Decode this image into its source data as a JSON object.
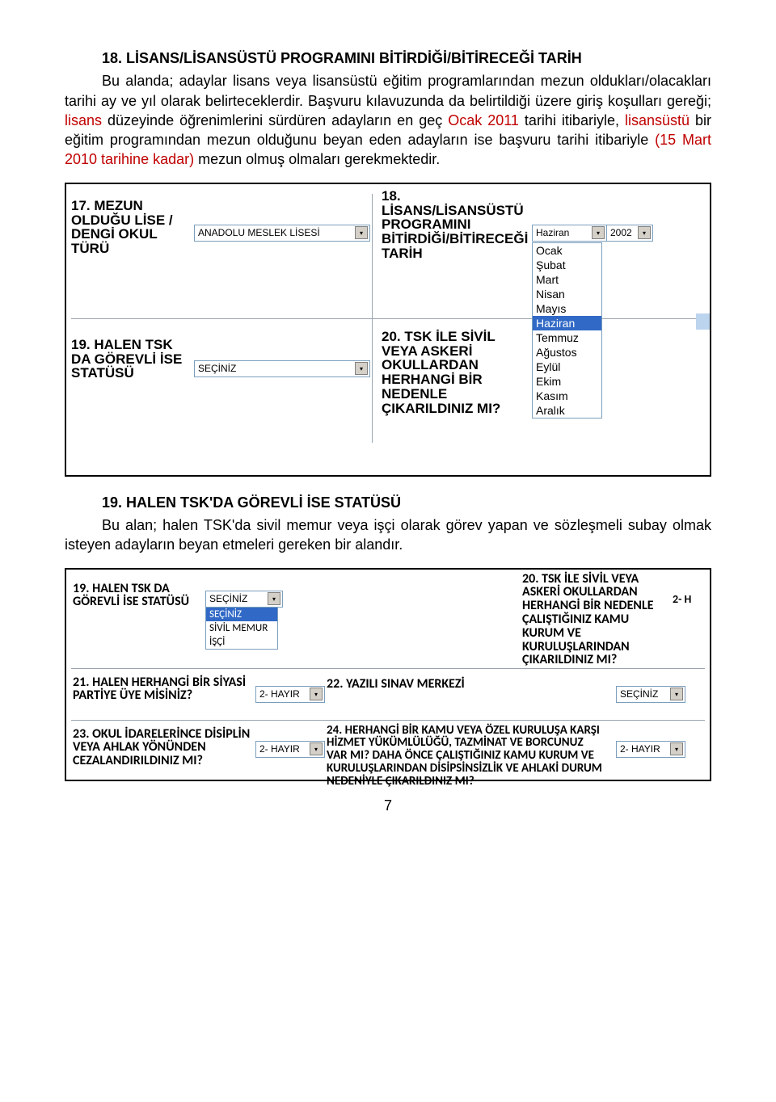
{
  "section18": {
    "title": "18.  LİSANS/LİSANSÜSTÜ PROGRAMINI BİTİRDİĞİ/BİTİRECEĞİ TARİH",
    "body_a": "Bu alanda; adaylar lisans veya lisansüstü eğitim programlarından mezun oldukları/olacakları tarihi ay ve yıl olarak belirteceklerdir. Başvuru kılavuzunda da belirtildiği üzere giriş koşulları gereği; ",
    "body_red1": "lisans",
    "body_b": " düzeyinde öğrenimlerini sürdüren adayların en geç ",
    "body_red2": "Ocak 2011",
    "body_c": " tarihi itibariyle, ",
    "body_red3": "lisansüstü",
    "body_d": " bir eğitim programından mezun olduğunu beyan eden adayların ise başvuru tarihi itibariyle  ",
    "body_red4": "(15 Mart 2010 tarihine kadar) ",
    "body_e": "mezun olmuş olmaları gerekmektedir."
  },
  "shot1": {
    "q17": "17. MEZUN OLDUĞU LİSE / DENGİ OKUL TÜRÜ",
    "q17_val": "ANADOLU MESLEK LİSESİ",
    "q18": "18. LİSANS/LİSANSÜSTÜ PROGRAMINI BİTİRDİĞİ/BİTİRECEĞİ TARİH",
    "q18_month": "Haziran",
    "q18_year": "2002",
    "months": [
      "Ocak",
      "Şubat",
      "Mart",
      "Nisan",
      "Mayıs",
      "Haziran",
      "Temmuz",
      "Ağustos",
      "Eylül",
      "Ekim",
      "Kasım",
      "Aralık"
    ],
    "q19": "19. HALEN TSK DA GÖREVLİ İSE STATÜSÜ",
    "q19_val": "SEÇİNİZ",
    "q20": "20. TSK İLE SİVİL VEYA ASKERİ OKULLARDAN HERHANGİ BİR NEDENLE ÇIKARILDINIZ MI?"
  },
  "section19": {
    "title": "19.  HALEN TSK'DA GÖREVLİ İSE STATÜSÜ",
    "body": "Bu alan; halen TSK'da sivil memur veya işçi olarak görev yapan ve sözleşmeli subay olmak isteyen adayların beyan etmeleri gereken bir alandır."
  },
  "shot2": {
    "q19": "19. HALEN TSK DA GÖREVLİ İSE STATÜSÜ",
    "sel19": "SEÇİNİZ",
    "opts19": [
      "SEÇİNİZ",
      "SİVİL MEMUR",
      "İŞÇİ"
    ],
    "q20": "20. TSK İLE SİVİL VEYA ASKERİ OKULLARDAN HERHANGİ BİR NEDENLE ÇALIŞTIĞINIZ KAMU KURUM VE KURULUŞLARINDAN ÇIKARILDINIZ MI?",
    "q20v": "2- H",
    "q21": "21. HALEN HERHANGİ BİR SİYASİ PARTİYE ÜYE MİSİNİZ?",
    "s21": "2- HAYIR",
    "q22": "22. YAZILI SINAV MERKEZİ",
    "s22": "SEÇİNİZ",
    "q23": "23. OKUL İDARELERİNCE DİSİPLİN VEYA AHLAK YÖNÜNDEN CEZALANDIRILDINIZ MI?",
    "s23": "2- HAYIR",
    "q24": "24. HERHANGİ BİR KAMU VEYA ÖZEL KURULUŞA KARŞI HİZMET YÜKÜMLÜLÜĞÜ, TAZMİNAT VE BORCUNUZ VAR MI? DAHA ÖNCE ÇALIŞTIĞINIZ KAMU KURUM VE KURULUŞLARINDAN DİSİPSİNSİZLİK VE AHLAKİ DURUM NEDENİYLE ÇIKARILDINIZ MI?",
    "s24": "2- HAYIR"
  },
  "pagenum": "7"
}
